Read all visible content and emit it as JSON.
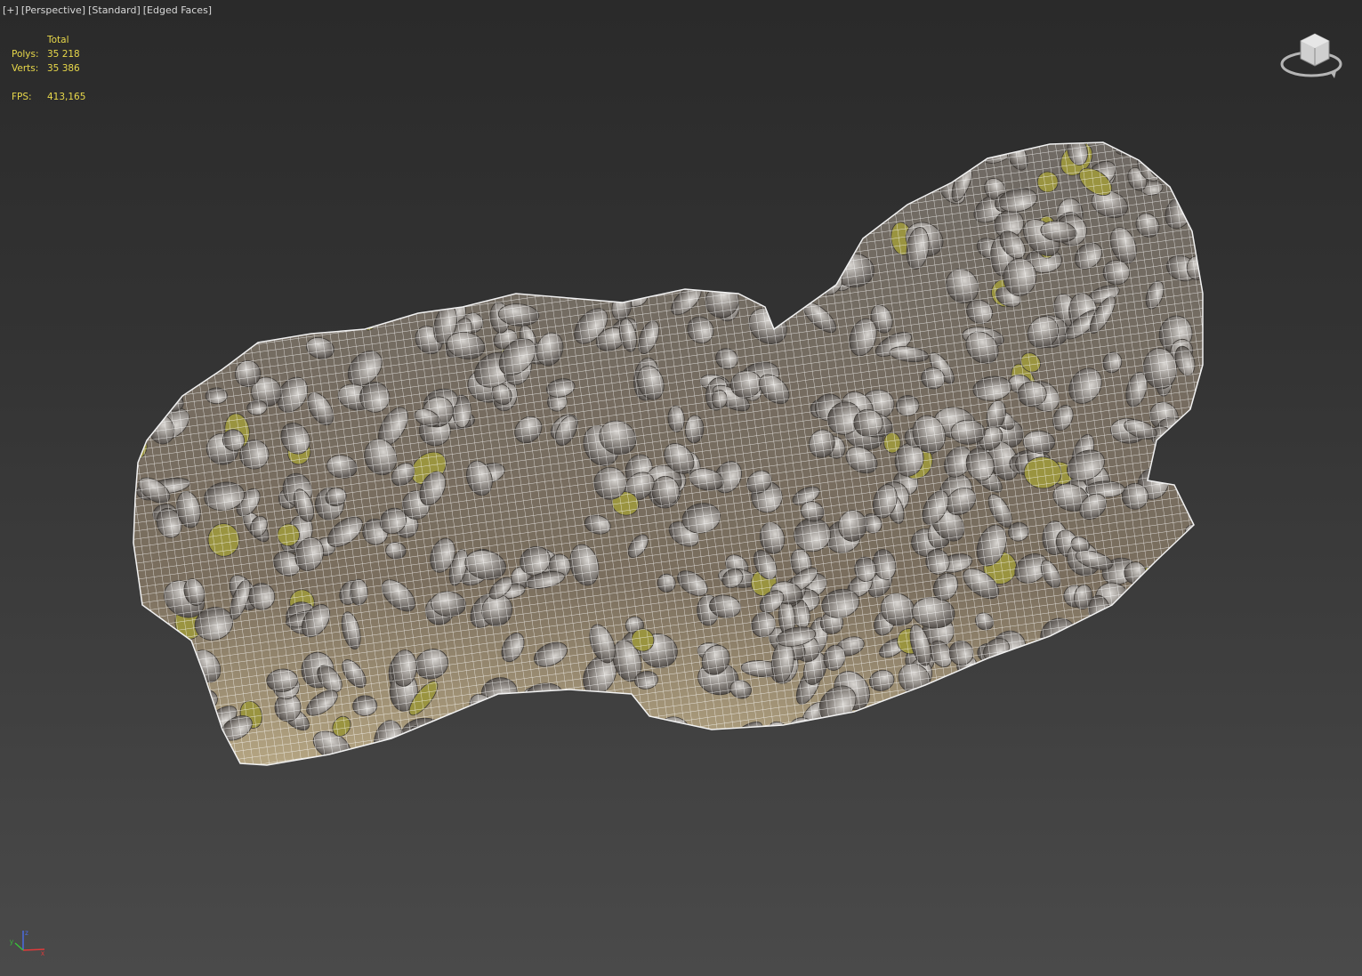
{
  "viewport": {
    "labels": [
      "[+]",
      "[Perspective]",
      "[Standard]",
      "[Edged Faces]"
    ]
  },
  "stats": {
    "header": "Total",
    "polys_label": "Polys:",
    "polys_value": "35 218",
    "verts_label": "Verts:",
    "verts_value": "35 386",
    "fps_label": "FPS:",
    "fps_value": "413,165"
  },
  "viewcube": {
    "icon": "viewcube-icon"
  },
  "axis_tripod": {
    "icon": "axis-tripod-icon"
  },
  "colors": {
    "stats_text": "#e8d84a",
    "label_text": "#d8d8d8",
    "wire": "#ffffff",
    "rock": "#8a8580",
    "moss": "#9a9440",
    "axis_x": "#e03a3a",
    "axis_y": "#3ac03a",
    "axis_z": "#4a6ae0"
  }
}
